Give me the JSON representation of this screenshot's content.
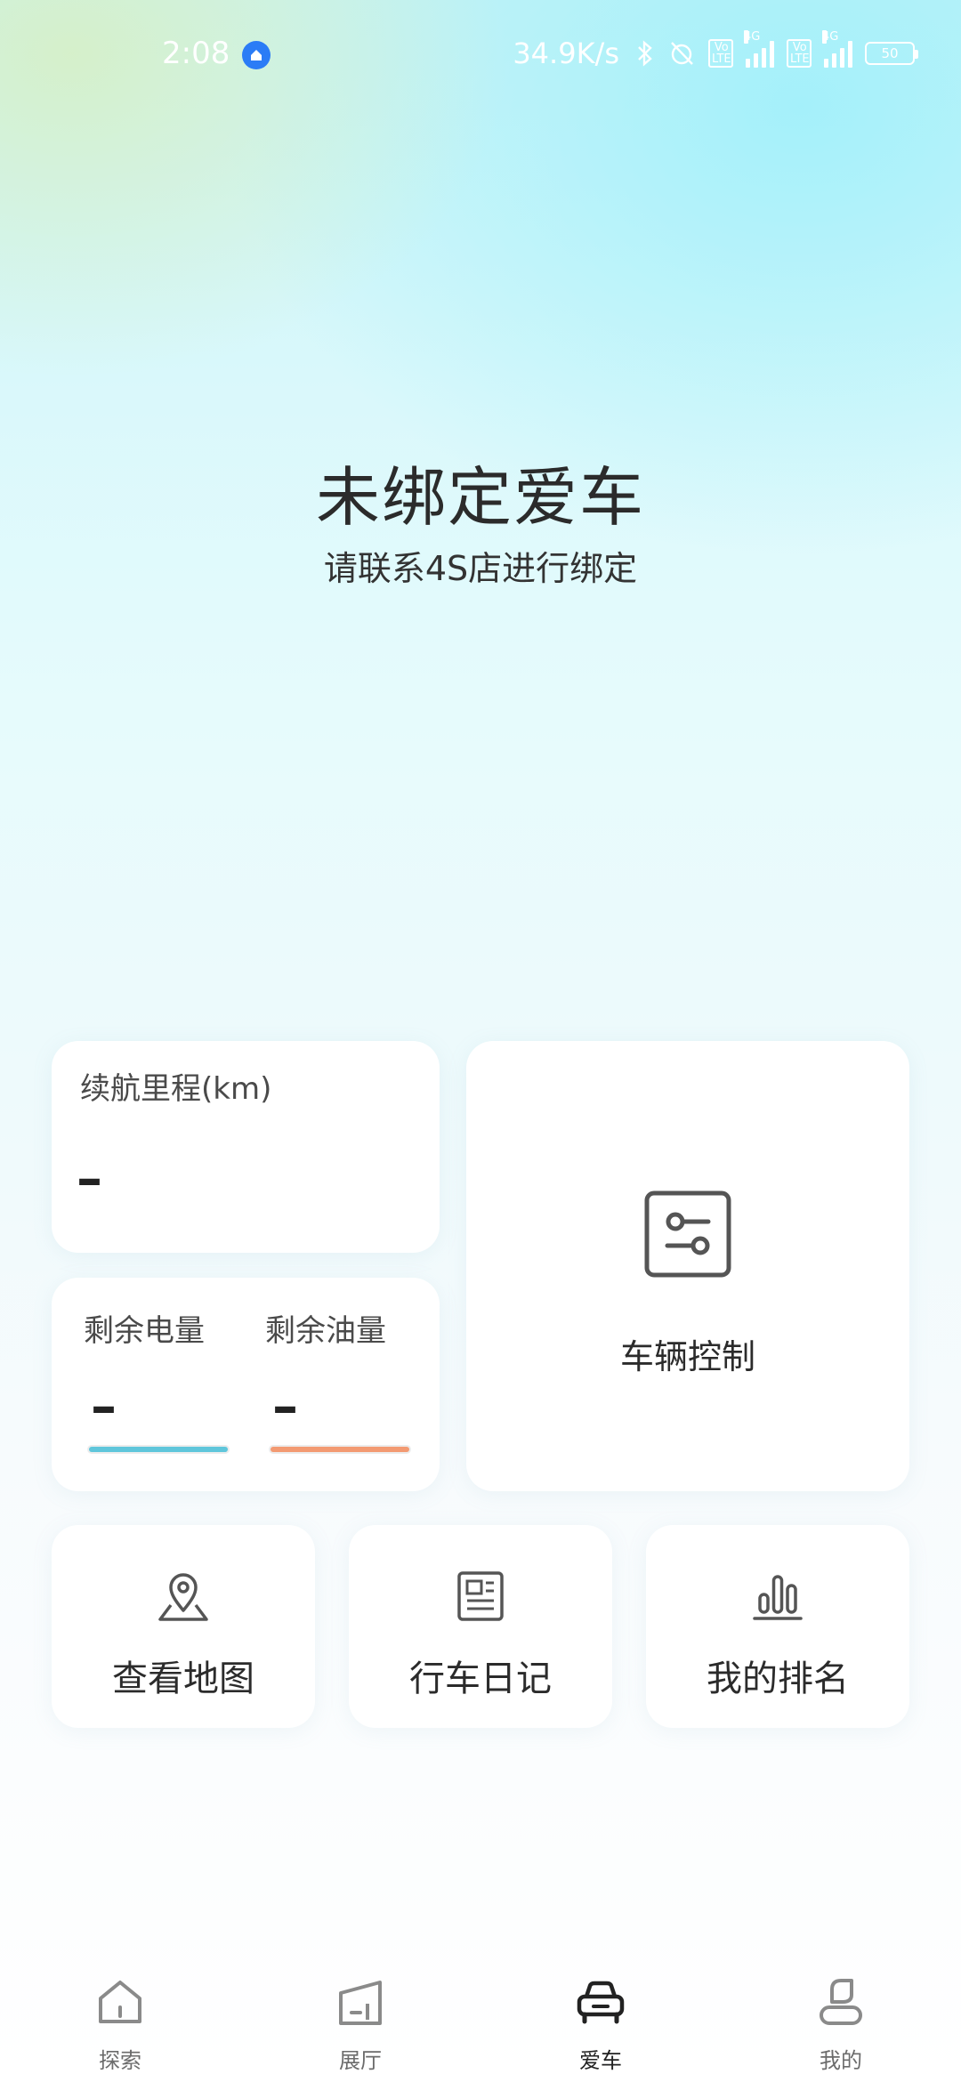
{
  "status_bar": {
    "time": "2:08",
    "network_speed": "34.9K/s",
    "lte_badge": "Vo LTE",
    "network_gen": "4G",
    "battery": "50"
  },
  "main": {
    "title": "未绑定爱车",
    "subtitle": "请联系4S店进行绑定"
  },
  "range_card": {
    "title": "续航里程(km)",
    "value": "–"
  },
  "energy_card": {
    "battery_label": "剩余电量",
    "battery_value": "–",
    "fuel_label": "剩余油量",
    "fuel_value": "–",
    "battery_color": "#5fc6db",
    "fuel_color": "#f39a72"
  },
  "control_card": {
    "label": "车辆控制"
  },
  "tiles": [
    {
      "label": "查看地图",
      "icon": "map-pin-icon"
    },
    {
      "label": "行车日记",
      "icon": "newspaper-icon"
    },
    {
      "label": "我的排名",
      "icon": "bar-chart-icon"
    }
  ],
  "bottom_nav": {
    "items": [
      {
        "label": "探索",
        "icon": "home-icon"
      },
      {
        "label": "展厅",
        "icon": "showroom-icon"
      },
      {
        "label": "爱车",
        "icon": "car-icon",
        "active": true
      },
      {
        "label": "我的",
        "icon": "person-icon"
      }
    ]
  }
}
